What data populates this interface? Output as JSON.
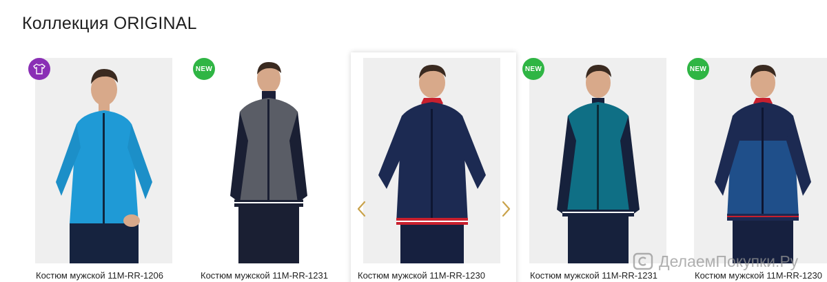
{
  "section": {
    "title": "Коллекция ORIGINAL"
  },
  "products": [
    {
      "caption": "Костюм мужской 11M-RR-1206",
      "badge": "",
      "badge_type": "shirt-icon",
      "jacket_color": "#1f9ad6"
    },
    {
      "caption": "Костюм мужской 11M-RR-1231",
      "badge": "NEW",
      "badge_type": "new",
      "jacket_color": "#5a5d66"
    },
    {
      "caption": "Костюм мужской 11M-RR-1230",
      "badge": "",
      "badge_type": "none",
      "jacket_color": "#1c2a52"
    },
    {
      "caption": "Костюм мужской 11M-RR-1231",
      "badge": "NEW",
      "badge_type": "new",
      "jacket_color": "#0f6f85"
    },
    {
      "caption": "Костюм мужской 11M-RR-1230",
      "badge": "NEW",
      "badge_type": "new",
      "jacket_color": "#1f4f8a"
    }
  ],
  "carousel": {
    "prev_icon": "chevron-left-icon",
    "next_icon": "chevron-right-icon",
    "arrow_color": "#c9a24a"
  },
  "colors": {
    "badge_new": "#2fb544",
    "badge_special": "#8a2fb5"
  },
  "watermark": {
    "text": "ДелаемПокупки.Ру"
  }
}
